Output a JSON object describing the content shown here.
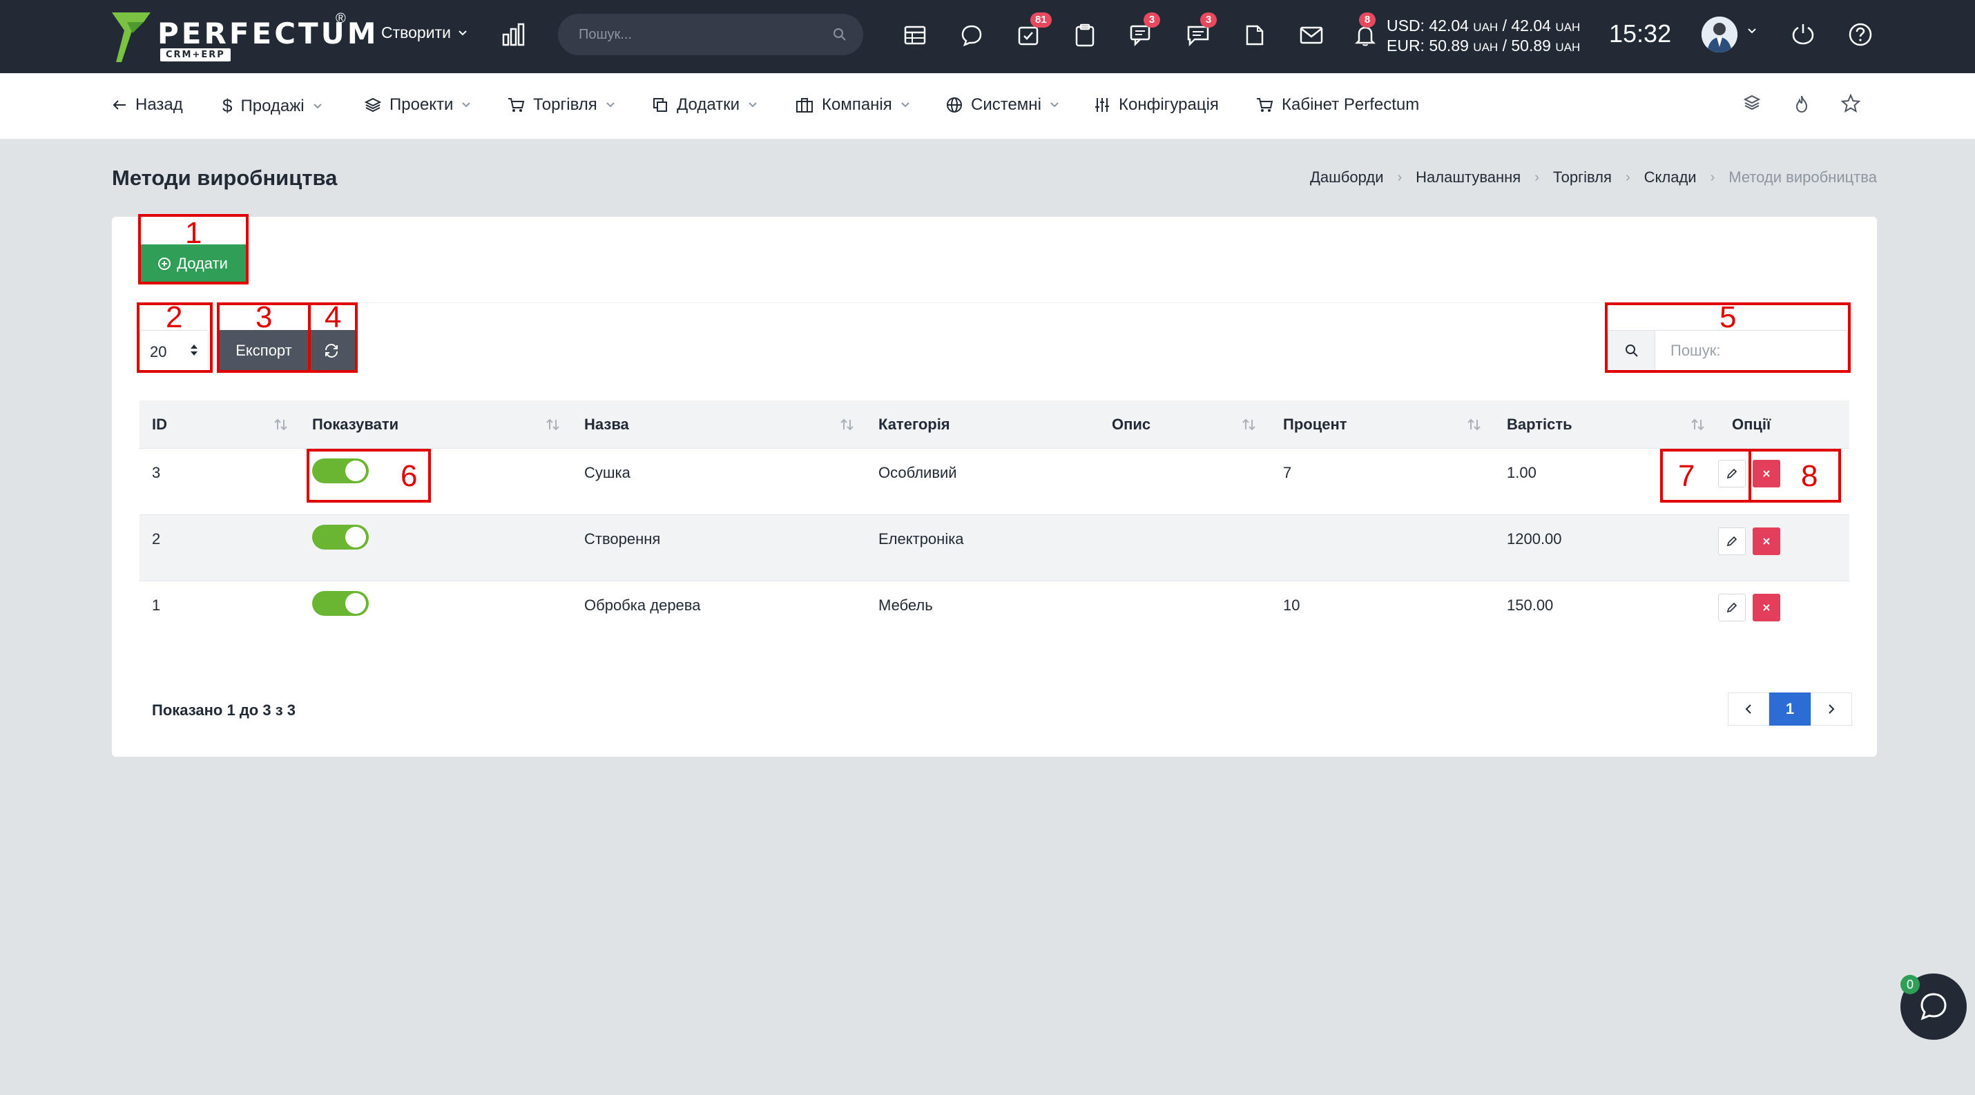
{
  "topbar": {
    "logo_text": "PERFECTUM",
    "logo_reg": "®",
    "logo_sub": "CRM+ERP",
    "create_label": "Створити",
    "search_placeholder": "Пошук...",
    "badges": {
      "tasks": "81",
      "chat": "3",
      "messages": "3",
      "notifications": "8"
    },
    "currency": {
      "usd_line": "USD: 42.04",
      "usd_rest": " / 42.04",
      "eur_line": "EUR: 50.89",
      "eur_rest": " / 50.89",
      "unit": "UAH"
    },
    "time": "15:32"
  },
  "nav": {
    "back": "Назад",
    "sales": "Продажі",
    "projects": "Проекти",
    "trade": "Торгівля",
    "addons": "Додатки",
    "company": "Компанія",
    "system": "Системні",
    "config": "Конфігурація",
    "cabinet": "Кабінет Perfectum"
  },
  "page": {
    "title": "Методи виробництва",
    "breadcrumb": [
      "Дашборди",
      "Налаштування",
      "Торгівля",
      "Склади",
      "Методи виробництва"
    ]
  },
  "toolbar": {
    "add_label": "Додати",
    "page_size": "20",
    "export_label": "Експорт",
    "search_placeholder": "Пошук:"
  },
  "table": {
    "columns": [
      "ID",
      "Показувати",
      "Назва",
      "Категорія",
      "Опис",
      "Процент",
      "Вартість",
      "Опції"
    ],
    "rows": [
      {
        "id": "3",
        "show": true,
        "name": "Сушка",
        "category": "Особливий",
        "description": "",
        "percent": "7",
        "cost": "1.00"
      },
      {
        "id": "2",
        "show": true,
        "name": "Створення",
        "category": "Електроніка",
        "description": "",
        "percent": "",
        "cost": "1200.00"
      },
      {
        "id": "1",
        "show": true,
        "name": "Обробка дерева",
        "category": "Мебель",
        "description": "",
        "percent": "10",
        "cost": "150.00"
      }
    ]
  },
  "footer": {
    "info": "Показано 1 до 3 з 3",
    "current_page": "1"
  },
  "annotations": [
    "1",
    "2",
    "3",
    "4",
    "5",
    "6",
    "7",
    "8"
  ],
  "chat": {
    "badge": "0"
  },
  "colors": {
    "topbar": "#222a35",
    "add_button": "#2f9e57",
    "toggle_on": "#6ab531",
    "delete": "#e33e5a",
    "pager_active": "#2c6dd5",
    "annotation": "#e00000"
  }
}
